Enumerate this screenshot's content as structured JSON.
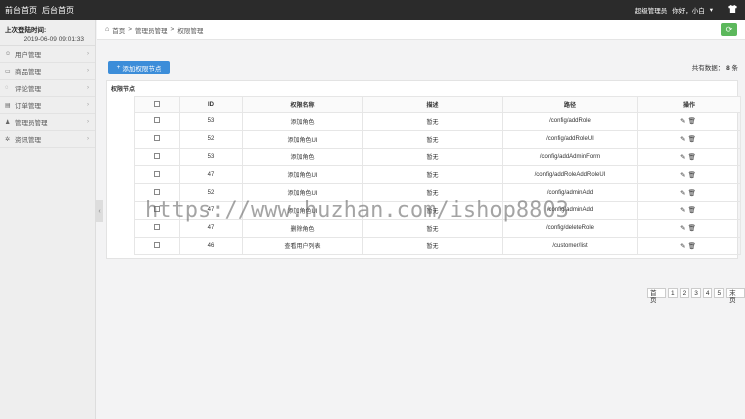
{
  "topbar": {
    "nav": [
      "前台首页",
      "后台首页"
    ],
    "admin_label": "超级管理员",
    "greeting": "你好，小白",
    "user_menu_glyph": "▾",
    "shirt_icon": "shirt-icon"
  },
  "sidebar": {
    "login_label": "上次登陆时间:",
    "login_time": "2019-06-09 09:01:33",
    "items": [
      {
        "label": "用户管理",
        "icon": "user-icon"
      },
      {
        "label": "商品管理",
        "icon": "goods-icon"
      },
      {
        "label": "评论管理",
        "icon": "comment-icon"
      },
      {
        "label": "订单管理",
        "icon": "order-icon"
      },
      {
        "label": "管理员管理",
        "icon": "admin-icon"
      },
      {
        "label": "资讯管理",
        "icon": "news-icon"
      }
    ]
  },
  "breadcrumb": {
    "items": [
      "首页",
      "管理员管理",
      "权限管理"
    ],
    "separator": ">"
  },
  "toolbar": {
    "add_label": "添加权限节点",
    "total_label": "共有数据：",
    "total_count": "8",
    "total_unit": "条"
  },
  "panel": {
    "title": "权限节点"
  },
  "table": {
    "columns": [
      "",
      "ID",
      "权限名称",
      "描述",
      "路径",
      "操作"
    ],
    "rows": [
      {
        "id": "53",
        "name": "添加角色",
        "desc": "暂无",
        "path": "/config/addRole"
      },
      {
        "id": "52",
        "name": "添加角色UI",
        "desc": "暂无",
        "path": "/config/addRoleUI"
      },
      {
        "id": "53",
        "name": "添加角色",
        "desc": "暂无",
        "path": "/config/addAdminForm"
      },
      {
        "id": "47",
        "name": "添加角色UI",
        "desc": "暂无",
        "path": "/config/addRoleAddRoleUI"
      },
      {
        "id": "52",
        "name": "添加角色UI",
        "desc": "暂无",
        "path": "/config/adminAdd"
      },
      {
        "id": "47",
        "name": "添加角色UI",
        "desc": "暂无",
        "path": "/config/adminAdd"
      },
      {
        "id": "47",
        "name": "删除角色",
        "desc": "暂无",
        "path": "/config/deleteRole"
      },
      {
        "id": "46",
        "name": "查看用户列表",
        "desc": "暂无",
        "path": "/customer/list"
      }
    ]
  },
  "pager": [
    "首页",
    "1",
    "2",
    "3",
    "4",
    "5",
    "末页"
  ],
  "watermark": "https://www.huzhan.com/ishop8803"
}
